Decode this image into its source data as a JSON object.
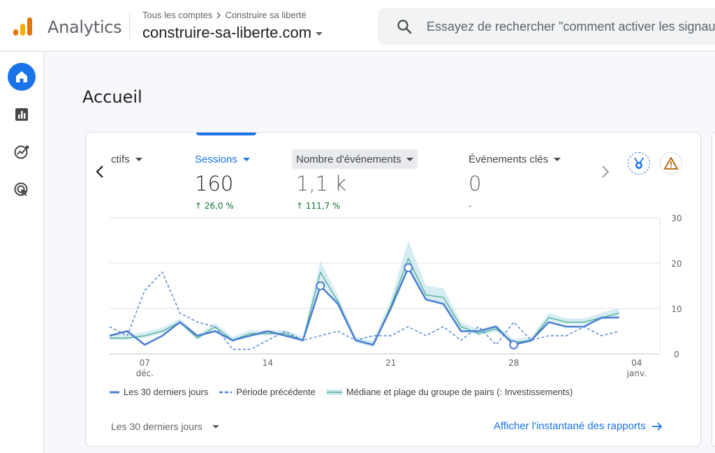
{
  "header": {
    "app_name": "Analytics",
    "breadcrumb": {
      "parent": "Tous les comptes",
      "current": "Construire sa liberté"
    },
    "property": "construire-sa-liberte.com",
    "search": {
      "placeholder": "Essayez de rechercher \"comment activer les signaux Google\""
    }
  },
  "sidebar": {
    "items": [
      {
        "name": "Accueil",
        "icon": "home-icon",
        "active": true
      },
      {
        "name": "Rapports",
        "icon": "reports-icon",
        "active": false
      },
      {
        "name": "Explorer",
        "icon": "explore-icon",
        "active": false
      },
      {
        "name": "Publicité",
        "icon": "advertising-icon",
        "active": false
      }
    ]
  },
  "page": {
    "title": "Accueil"
  },
  "card": {
    "metrics": [
      {
        "label": "ctifs",
        "value": "",
        "change": ""
      },
      {
        "label": "Sessions",
        "value": "160",
        "change": "26,0 %",
        "selected": true
      },
      {
        "label": "Nombre d'événements",
        "value": "1,1 k",
        "change": "111,7 %"
      },
      {
        "label": "Événements clés",
        "value": "0",
        "change": "-"
      }
    ],
    "legend": {
      "current": "Les 30 derniers jours",
      "previous": "Période précédente",
      "benchmark": "Médiane et plage du groupe de pairs (: Investissements)"
    },
    "footer": {
      "range_label": "Les 30 derniers jours",
      "link_label": "Afficher l'instantané des rapports"
    }
  },
  "colors": {
    "accent": "#1a73e8",
    "positive": "#137333",
    "current_line": "#4a7fd1",
    "benchmark_line": "#4caf8a",
    "benchmark_band": "#cfe9f3"
  },
  "chart_data": {
    "type": "line",
    "x": [
      "5 déc.",
      "6 déc.",
      "7 déc.",
      "8 déc.",
      "9 déc.",
      "10 déc.",
      "11 déc.",
      "12 déc.",
      "13 déc.",
      "14 déc.",
      "15 déc.",
      "16 déc.",
      "17 déc.",
      "18 déc.",
      "19 déc.",
      "20 déc.",
      "21 déc.",
      "22 déc.",
      "23 déc.",
      "24 déc.",
      "25 déc.",
      "26 déc.",
      "27 déc.",
      "28 déc.",
      "29 déc.",
      "30 déc.",
      "31 déc.",
      "1 janv.",
      "2 janv.",
      "3 janv.",
      "4 janv.",
      "5 janv."
    ],
    "x_tick_labels": [
      {
        "label": "07",
        "sublabel": "déc.",
        "index": 2
      },
      {
        "label": "14",
        "sublabel": "",
        "index": 9
      },
      {
        "label": "21",
        "sublabel": "",
        "index": 16
      },
      {
        "label": "28",
        "sublabel": "",
        "index": 23
      },
      {
        "label": "04",
        "sublabel": "janv.",
        "index": 30
      }
    ],
    "ylim": [
      0,
      30
    ],
    "y_ticks": [
      0,
      10,
      20,
      30
    ],
    "grid": true,
    "series": [
      {
        "name": "Les 30 derniers jours",
        "style": "solid",
        "values": [
          4,
          5,
          2,
          4,
          7,
          4,
          5,
          3,
          4,
          5,
          4,
          3,
          15,
          11,
          3,
          2,
          10,
          19,
          12,
          11,
          5,
          5,
          6,
          2,
          3,
          7,
          6,
          6,
          8,
          8
        ],
        "markers": [
          12,
          17,
          23
        ]
      },
      {
        "name": "Période précédente",
        "style": "dashed",
        "values": [
          6,
          4,
          14,
          18,
          9,
          7,
          6,
          1,
          1,
          3,
          5,
          3,
          4,
          5,
          3,
          4,
          4,
          6,
          4,
          6,
          3,
          6,
          2,
          7,
          3,
          4,
          4,
          6,
          4,
          5
        ]
      },
      {
        "name": "Médiane et plage du groupe de pairs (: Investissements)",
        "style": "band",
        "values": [
          3.5,
          3.5,
          4,
          5,
          7,
          3.5,
          6,
          3,
          4.5,
          4.5,
          4.5,
          3,
          18,
          11.5,
          3,
          2,
          10.5,
          21,
          13,
          12.5,
          6,
          4.5,
          5.5,
          2.5,
          3,
          8,
          7,
          7,
          8,
          9
        ],
        "upper": [
          4.2,
          4.2,
          4.8,
          5.8,
          7.8,
          4.2,
          6.8,
          3.8,
          5.2,
          5.2,
          5.2,
          3.8,
          20.5,
          12.8,
          3.8,
          2.8,
          12,
          25,
          15,
          14.5,
          7,
          5.4,
          6.4,
          3.2,
          3.8,
          9,
          7.8,
          7.8,
          9,
          10.2
        ]
      }
    ]
  }
}
